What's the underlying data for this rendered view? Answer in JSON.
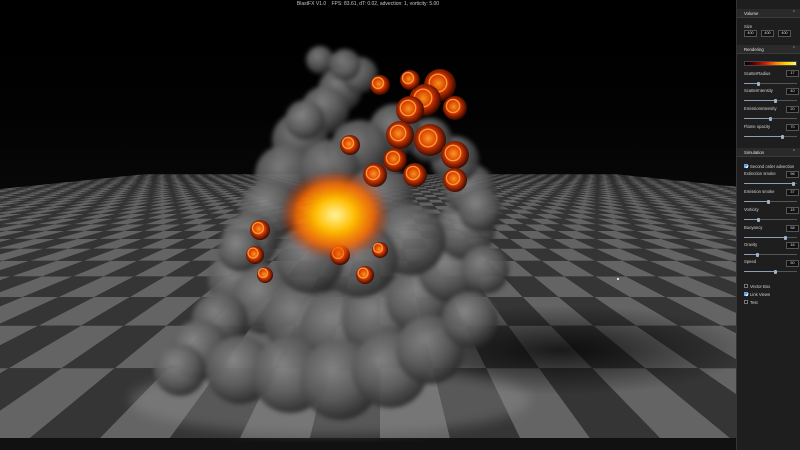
{
  "title_bar": {
    "app": "BlastFX V1.0",
    "stats": "FPS: 83.61, dT: 0.02, advection: 1, vorticity: 5.00"
  },
  "panel": {
    "volume": {
      "header": "Volume",
      "size_label": "Size",
      "size": [
        "400",
        "400",
        "400"
      ]
    },
    "rendering": {
      "header": "Rendering",
      "colormap_colors": [
        "#000000",
        "#6a0000",
        "#d21a00",
        "#ff7a00",
        "#ffd000",
        "#fff27a"
      ],
      "scatter_radius_label": "ScatterRadius",
      "scatter_radius": "17",
      "scatter_radius_level": 0.27,
      "scatter_intensity_label": "ScatterIntensity",
      "scatter_intensity": "40",
      "scatter_intensity_level": 0.6,
      "emission_intensity_label": "EmissionIntensity",
      "emission_intensity": "20",
      "emission_intensity_level": 0.5,
      "flame_opacity_label": "Flame opacity",
      "flame_opacity": "70",
      "flame_opacity_level": 0.72
    },
    "simulation": {
      "header": "Simulation",
      "second_order_label": "Second order advection",
      "second_order_checked": true,
      "extinction_smoke_label": "Extinction smoke",
      "extinction_smoke": "96",
      "extinction_smoke_level": 0.93,
      "emission_smoke_label": "Emission smoke",
      "emission_smoke": "37",
      "emission_smoke_level": 0.47,
      "vorticity_label": "Vorticity",
      "vorticity": "15",
      "vorticity_level": 0.28,
      "buoyancy_label": "Buoyancy",
      "buoyancy": "58",
      "buoyancy_level": 0.78,
      "gravity_label": "Gravity",
      "gravity": "16",
      "gravity_level": 0.25,
      "speed_label": "Speed",
      "speed": "50",
      "speed_level": 0.6
    },
    "options": {
      "vector_box_label": "Vector Box",
      "vector_box_checked": false,
      "link_views_label": "Link Views",
      "link_views_checked": true,
      "test_label": "Test",
      "test_checked": false
    }
  },
  "colors": {
    "panel_bg": "#1e1e1e",
    "accent": "#4a8fd8",
    "floor_light": "#6e6e6e",
    "floor_dark": "#3a3a3a",
    "smoke": "#555555",
    "fire_core": "#ffd000"
  },
  "icons": [
    "chevron-up-icon",
    "checkbox-icon"
  ]
}
